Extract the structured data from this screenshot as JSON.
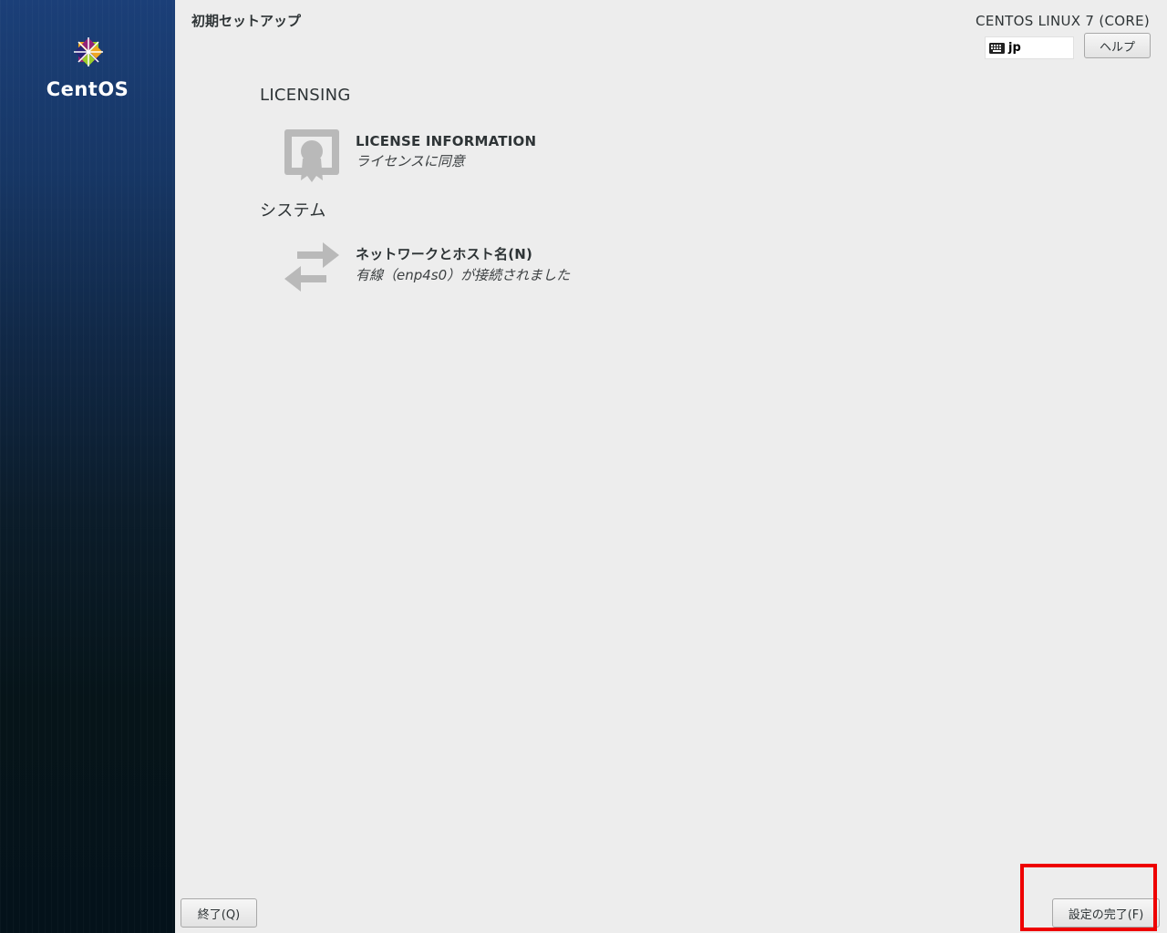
{
  "sidebar": {
    "logo_text": "CentOS"
  },
  "header": {
    "page_title": "初期セットアップ",
    "product_title": "CENTOS LINUX 7 (CORE)",
    "keyboard_layout": "jp",
    "help_label": "ヘルプ"
  },
  "sections": [
    {
      "heading": "LICENSING",
      "items": [
        {
          "title": "LICENSE INFORMATION",
          "status": "ライセンスに同意",
          "icon": "license-certificate-icon"
        }
      ]
    },
    {
      "heading": "システム",
      "items": [
        {
          "title": "ネットワークとホスト名(N)",
          "status": "有線（enp4s0）が接続されました",
          "icon": "network-arrows-icon"
        }
      ]
    }
  ],
  "footer": {
    "quit_label": "終了(Q)",
    "finish_label": "設定の完了(F)"
  },
  "colors": {
    "highlight": "#ee0000",
    "sidebar_top": "#1b3f78",
    "sidebar_bottom": "#04121a",
    "background": "#ededed"
  }
}
